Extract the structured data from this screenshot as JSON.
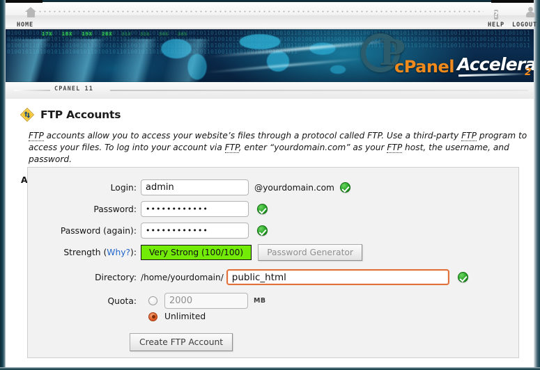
{
  "window": {
    "accent_orange": "#f08a1c",
    "accent_blue": "#2c5c6b",
    "focus_orange": "#e2703a",
    "strength_green": "#72ec07"
  },
  "topnav": {
    "home": {
      "label": "HOME",
      "icon": "home-icon"
    },
    "help": {
      "label": "HELP",
      "icon": "question-mark-icon"
    },
    "logout": {
      "label": "LOGOUT",
      "icon": "user-icon"
    }
  },
  "banner": {
    "logo_c": "P",
    "logo_cpanel": "cPanel",
    "logo_accelerated": "Accelerated",
    "logo_superscript": "2",
    "stat_numbers": [
      "17X",
      "18X",
      "19X",
      "26X",
      "31X",
      "32X",
      "34X",
      "36X"
    ],
    "binary_texture": "01001101010010110100101101001011010010110100101101001011010010110100101101001011010010110100101101001011010010110100101101001011010010110100101101001011010010110100101101001011010010110100101101001011010010110100101101001011010010110100101101001011010010110100101101001011010010110100101101001011010010110100101101001011010010110100101101001011010010110100101101001011010010110100101101001011010010110100101101001011010010110100101101001011010010110100101101001011010010110100101101001011010010110100101101001011"
  },
  "breadcrumb": {
    "label": "CPANEL 11"
  },
  "page": {
    "icon": "ftp-transfer-icon",
    "title": "FTP Accounts",
    "description_parts": {
      "a": "FTP",
      "b": " accounts allow you to access your website’s files through a protocol called FTP. Use a third-party ",
      "c": "FTP",
      "d": " program to access your files. To log into your account via ",
      "e": "FTP",
      "f": ", enter “yourdomain.com” as your ",
      "g": "FTP",
      "h": " host, the username, and password."
    },
    "section_title": "Add FTP Account"
  },
  "form": {
    "login": {
      "label": "Login:",
      "value": "admin",
      "placeholder": "",
      "suffix": "@yourdomain.com",
      "valid_icon": "green-check-icon"
    },
    "password": {
      "label": "Password:",
      "value": "••••••••••••",
      "valid_icon": "green-check-icon"
    },
    "password_again": {
      "label": "Password (again):",
      "value": "••••••••••••",
      "valid_icon": "green-check-icon"
    },
    "strength": {
      "label_prefix": "Strength (",
      "label_link": "Why?",
      "label_suffix": "):",
      "badge": "Very Strong (100/100)",
      "generator_button": "Password Generator"
    },
    "directory": {
      "label": "Directory:",
      "path_prefix": "/home/yourdomain/",
      "value": "public_html",
      "valid_icon": "green-check-icon"
    },
    "quota": {
      "label": "Quota:",
      "amount_value": "2000",
      "unit": "MB",
      "unlimited_label": "Unlimited",
      "amount_selected": false,
      "unlimited_selected": true
    },
    "submit": {
      "label": "Create FTP Account"
    }
  }
}
